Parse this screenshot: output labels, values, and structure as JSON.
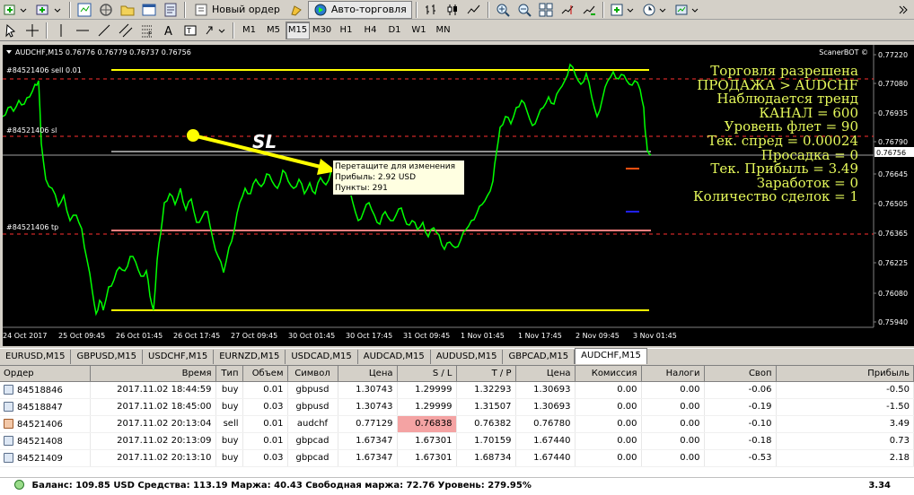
{
  "toolbar": {
    "new_order_label": "Новый ордер",
    "auto_trading_label": "Авто-торговля",
    "timeframes": [
      "M1",
      "M5",
      "M15",
      "M30",
      "H1",
      "H4",
      "D1",
      "W1",
      "MN"
    ],
    "active_timeframe": "M15"
  },
  "chart": {
    "header": "AUDCHF,M15  0.76776 0.76779 0.76737 0.76756",
    "brand": "ScanerBOT ©",
    "symbol": "AUDCHF",
    "timeframe": "M15",
    "current_price": "0.76756",
    "price_axis": [
      "0.77220",
      "0.77080",
      "0.76935",
      "0.76790",
      "0.76645",
      "0.76505",
      "0.76365",
      "0.76225",
      "0.76080",
      "0.75940"
    ],
    "time_axis": [
      "24 Oct 2017",
      "25 Oct 09:45",
      "26 Oct 01:45",
      "26 Oct 17:45",
      "27 Oct 09:45",
      "30 Oct 01:45",
      "30 Oct 17:45",
      "31 Oct 09:45",
      "1 Nov 01:45",
      "1 Nov 17:45",
      "2 Nov 09:45",
      "3 Nov 01:45"
    ],
    "order_labels": {
      "sell": "#84521406 sell 0.01",
      "sl": "#84521406 sl",
      "tp": "#84521406 tp"
    },
    "sl_arrow_label": "SL",
    "tooltip": {
      "line1": "Перетащите для изменения",
      "line2": "Прибыль: 2.92 USD",
      "line3": "Пункты: 291"
    },
    "info_lines": [
      "Торговля разрешена",
      "ПРОДАЖА > AUDCHF",
      "Наблюдается тренд",
      "КАНАЛ = 600",
      "Уровень флет = 90",
      "Тек. спред =  0.00024",
      "Просадка  = 0",
      "Тек. Прибыль = 3.49",
      "Заработок  = 0",
      "Количество сделок = 1"
    ],
    "colors": {
      "background": "#000000",
      "price_line": "#00ff00",
      "channel": "#ffff00",
      "sl_line": "#ff0000",
      "tp_line": "#ff6060",
      "info_text": "#e5f85a"
    }
  },
  "tabs": [
    "EURUSD,M15",
    "GBPUSD,M15",
    "USDCHF,M15",
    "EURNZD,M15",
    "USDCAD,M15",
    "AUDCAD,M15",
    "AUDUSD,M15",
    "GBPCAD,M15",
    "AUDCHF,M15"
  ],
  "active_tab": "AUDCHF,M15",
  "terminal": {
    "columns": [
      "Ордер",
      "Время",
      "Тип",
      "Объем",
      "Символ",
      "Цена",
      "S / L",
      "T / P",
      "Цена",
      "Комиссия",
      "Налоги",
      "Своп",
      "Прибыль"
    ],
    "rows": [
      {
        "order": "84518846",
        "time": "2017.11.02 18:44:59",
        "type": "buy",
        "volume": "0.01",
        "symbol": "gbpusd",
        "price": "1.30743",
        "sl": "1.29999",
        "tp": "1.32293",
        "cur": "1.30693",
        "commission": "0.00",
        "taxes": "0.00",
        "swap": "-0.06",
        "profit": "-0.50"
      },
      {
        "order": "84518847",
        "time": "2017.11.02 18:45:00",
        "type": "buy",
        "volume": "0.03",
        "symbol": "gbpusd",
        "price": "1.30743",
        "sl": "1.29999",
        "tp": "1.31507",
        "cur": "1.30693",
        "commission": "0.00",
        "taxes": "0.00",
        "swap": "-0.19",
        "profit": "-1.50"
      },
      {
        "order": "84521406",
        "time": "2017.11.02 20:13:04",
        "type": "sell",
        "volume": "0.01",
        "symbol": "audchf",
        "price": "0.77129",
        "sl": "0.76838",
        "tp": "0.76382",
        "cur": "0.76780",
        "commission": "0.00",
        "taxes": "0.00",
        "swap": "-0.10",
        "profit": "3.49"
      },
      {
        "order": "84521408",
        "time": "2017.11.02 20:13:09",
        "type": "buy",
        "volume": "0.01",
        "symbol": "gbpcad",
        "price": "1.67347",
        "sl": "1.67301",
        "tp": "1.70159",
        "cur": "1.67440",
        "commission": "0.00",
        "taxes": "0.00",
        "swap": "-0.18",
        "profit": "0.73"
      },
      {
        "order": "84521409",
        "time": "2017.11.02 20:13:10",
        "type": "buy",
        "volume": "0.03",
        "symbol": "gbpcad",
        "price": "1.67347",
        "sl": "1.67301",
        "tp": "1.68734",
        "cur": "1.67440",
        "commission": "0.00",
        "taxes": "0.00",
        "swap": "-0.53",
        "profit": "2.18"
      }
    ],
    "balance_line": "Баланс: 109.85 USD  Средства: 113.19  Маржа: 40.43  Свободная маржа: 72.76  Уровень: 279.95%",
    "total_profit": "3.34"
  }
}
